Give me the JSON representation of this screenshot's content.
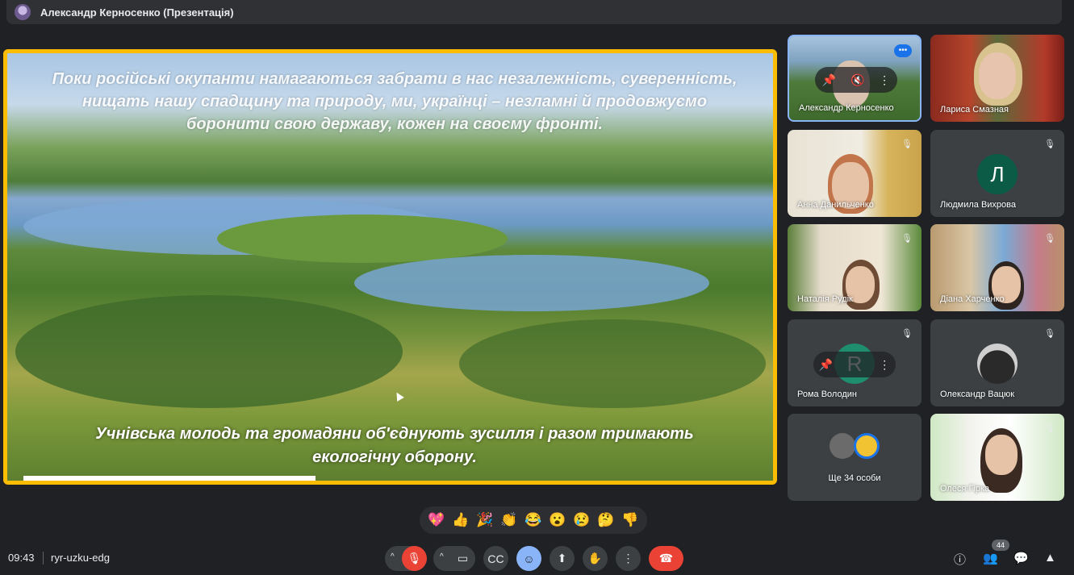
{
  "topbar": {
    "title": "Александр Керносенко (Презентація)"
  },
  "presentation": {
    "top_text": "Поки російські окупанти намагаються забрати в нас незалежність, суверенність, нищать нашу спадщину та природу, ми, українці – незламні й продовжуємо боронити свою державу, кожен на своєму фронті.",
    "bottom_text": "Учнівська молодь та громадяни об'єднують зусилля і разом тримають екологічну оборону."
  },
  "participants": [
    {
      "name": "Александр Керносенко"
    },
    {
      "name": "Лариса Смазная"
    },
    {
      "name": "Анна Данильченко"
    },
    {
      "name": "Людмила Вихрова",
      "initial": "Л"
    },
    {
      "name": "Наталія Рудік"
    },
    {
      "name": "Діана Харченко"
    },
    {
      "name": "Рома Володин"
    },
    {
      "name": "Олександр Вацюк"
    },
    {
      "name": "Ще 34 особи"
    },
    {
      "name": "Олеся Гірка"
    }
  ],
  "reactions": [
    "💖",
    "👍",
    "🎉",
    "👏",
    "😂",
    "😮",
    "😢",
    "🤔",
    "👎"
  ],
  "bottombar": {
    "time": "09:43",
    "meeting_code": "ryr-uzku-edg",
    "participant_count": "44"
  }
}
